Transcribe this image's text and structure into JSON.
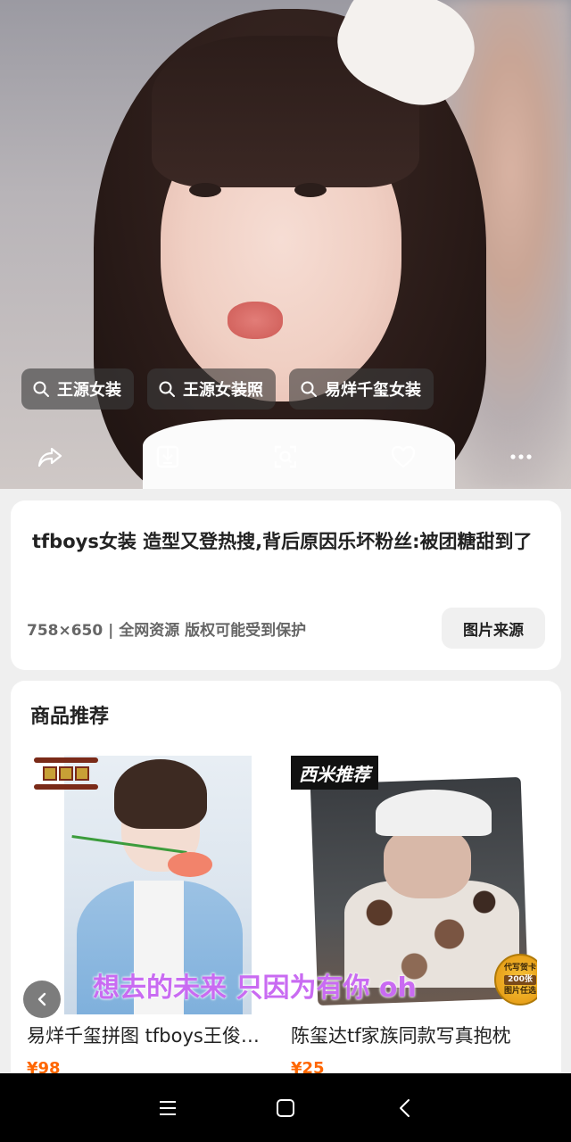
{
  "search_tags": [
    {
      "label": "王源女装",
      "icon": "search-icon"
    },
    {
      "label": "王源女装照",
      "icon": "search-icon"
    },
    {
      "label": "易烊千玺女装",
      "icon": "search-icon"
    }
  ],
  "actions": [
    "share-icon",
    "download-icon",
    "scan-icon",
    "heart-icon",
    "more-icon"
  ],
  "info": {
    "title": "tfboys女装 造型又登热搜,背后原因乐坏粉丝:被团糖甜到了",
    "meta": "758×650 | 全网资源 版权可能受到保护",
    "source_button": "图片来源"
  },
  "recommend": {
    "heading": "商品推荐",
    "products": [
      {
        "name": "易烊千玺拼图 tfboys王俊凯王源周边",
        "price": "¥98"
      },
      {
        "name": "陈玺达tf家族同款写真抱枕",
        "price": "¥25",
        "badge": "西米推荐",
        "stamp": [
          "代写贺卡",
          "200张",
          "图片任选"
        ]
      }
    ]
  },
  "overlay_lyric": "想去的未来 只因为有你 oh",
  "navbar": [
    "menu-icon",
    "home-icon",
    "back-icon"
  ],
  "colors": {
    "price": "#ff6600",
    "lyric": "#c96bf2",
    "tag_bg": "rgba(60,60,60,0.62)"
  }
}
